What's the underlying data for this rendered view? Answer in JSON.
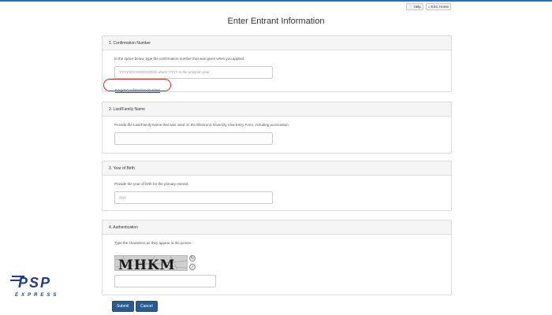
{
  "topbar": {
    "help_label": "Help",
    "esc_home_label": "ESC Home"
  },
  "page_title": "Enter Entrant Information",
  "sections": [
    {
      "title": "1. Confirmation Number",
      "help": "In the space below, type the confirmation number that was given when you applied.",
      "placeholder": "YYYYXXXXXXXXXXXX where YYYY is the program year",
      "forgot_link": "Forgot Confirmation Number"
    },
    {
      "title": "2. Last/Family Name",
      "help": "Provide the Last/Family Name that was used on the Electronic Diversity Visa Entry Form, including punctuation.",
      "placeholder": ""
    },
    {
      "title": "3. Year of Birth",
      "help": "Provide the year of birth for the primary entrant.",
      "placeholder": "yyyy"
    },
    {
      "title": "4. Authentication",
      "help": "Type the characters as they appear in the picture.",
      "captcha_text": "MHKM",
      "refresh_icon": "refresh-icon",
      "audio_icon": "audio-icon",
      "placeholder": ""
    }
  ],
  "actions": {
    "submit_label": "Submit",
    "cancel_label": "Cancel"
  },
  "logo": {
    "brand": "PSP",
    "tagline": "EXPRESS"
  },
  "colors": {
    "accent": "#2a6db5",
    "button": "#2a5b8e",
    "link": "#1a4f9c",
    "highlight_ring": "#d9262b"
  }
}
